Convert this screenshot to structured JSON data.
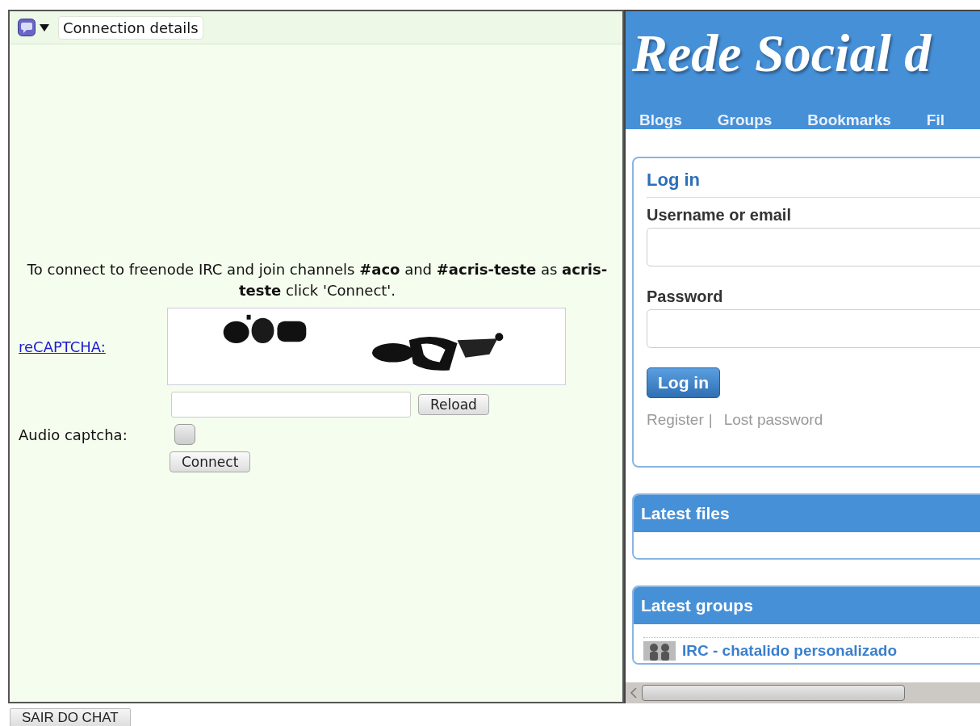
{
  "irc_panel": {
    "tab": {
      "label": "Connection details"
    },
    "intro": "To connect to freenode IRC and join channels **#aco** and **#acris-teste** as **acris-teste** click 'Connect'.",
    "captcha_link": "reCAPTCHA:",
    "reload_button": "Reload",
    "audio_captcha": {
      "label": "Audio captcha:",
      "checked": false
    },
    "connect_button": "Connect"
  },
  "site": {
    "title": "Rede Social d",
    "nav": [
      {
        "label": "Blogs"
      },
      {
        "label": "Groups"
      },
      {
        "label": "Bookmarks"
      },
      {
        "label": "Fil"
      }
    ],
    "login": {
      "title": "Log in",
      "username_label": "Username or email",
      "password_label": "Password",
      "submit": "Log in",
      "register_link": "Register",
      "separator": "|",
      "lost_password_link": "Lost password"
    },
    "modules": [
      {
        "title": "Latest files"
      },
      {
        "title": "Latest groups",
        "items": [
          {
            "name": "IRC - chatalido personalizado"
          }
        ]
      }
    ]
  },
  "exit_button": "SAIR DO CHAT"
}
